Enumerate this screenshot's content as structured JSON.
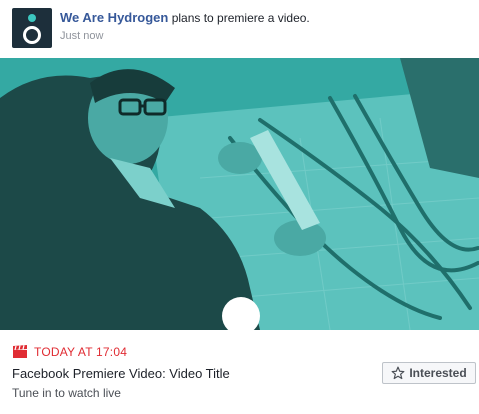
{
  "post": {
    "page_name": "We Are Hydrogen",
    "action_text": " plans to premiere a video.",
    "timestamp": "Just now"
  },
  "video": {
    "tint_color": "#2e9f9a",
    "play_icon": "play-circle"
  },
  "event": {
    "time_label": "TODAY AT 17:04",
    "title": "Facebook Premiere Video: Video Title",
    "subtitle": "Tune in to watch live",
    "interested_label": "Interested",
    "accent_color": "#e02c33"
  }
}
